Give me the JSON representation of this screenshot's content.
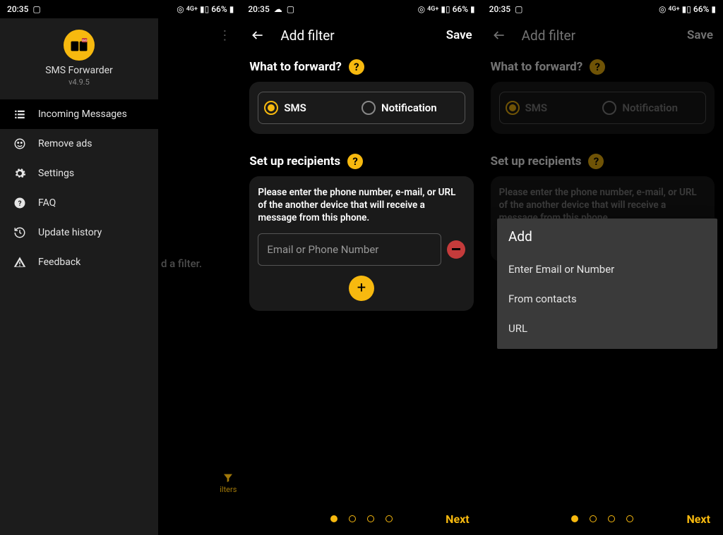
{
  "status": {
    "time": "20:35",
    "battery": "66%"
  },
  "screen1": {
    "drawer": {
      "app_name": "SMS Forwarder",
      "version": "v4.9.5",
      "items": [
        {
          "label": "Incoming Messages"
        },
        {
          "label": "Remove ads"
        },
        {
          "label": "Settings"
        },
        {
          "label": "FAQ"
        },
        {
          "label": "Update history"
        },
        {
          "label": "Feedback"
        }
      ]
    },
    "behind_hint": "d a filter.",
    "fab_label": "ilters"
  },
  "screen2": {
    "title": "Add filter",
    "save": "Save",
    "section_forward": "What to forward?",
    "opt_sms": "SMS",
    "opt_notif": "Notification",
    "section_recipients": "Set up recipients",
    "instruction": "Please enter the phone number, e-mail, or URL of the another device that will receive a message from this phone.",
    "input_placeholder": "Email or Phone Number",
    "next": "Next"
  },
  "screen3": {
    "title": "Add filter",
    "save": "Save",
    "section_forward": "What to forward?",
    "opt_sms": "SMS",
    "opt_notif": "Notification",
    "section_recipients": "Set up recipients",
    "instruction": "Please enter the phone number, e-mail, or URL of the another device that will receive a message from this phone.",
    "popup": {
      "title": "Add",
      "items": [
        {
          "label": "Enter Email or Number"
        },
        {
          "label": "From contacts"
        },
        {
          "label": "URL"
        }
      ]
    },
    "next": "Next"
  }
}
